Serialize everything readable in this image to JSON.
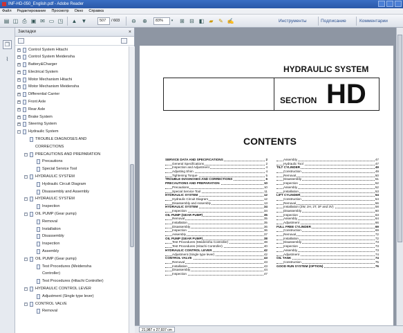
{
  "window": {
    "title": "INF-HD-050_English.pdf - Adobe Reader"
  },
  "menu": [
    "Файл",
    "Редактирование",
    "Просмотр",
    "Окно",
    "Справка"
  ],
  "toolbar": {
    "page_current": "507",
    "page_total": "/ 603",
    "zoom": "83%",
    "links": [
      "Инструменты",
      "Подписание",
      "Комментарии"
    ]
  },
  "panel": {
    "title": "Закладки"
  },
  "tree": [
    {
      "label": "Control System Hitachi",
      "level": 0,
      "exp": "+"
    },
    {
      "label": "Control System Meidensha",
      "level": 0,
      "exp": "+"
    },
    {
      "label": "Battery&Charger",
      "level": 0,
      "exp": "+"
    },
    {
      "label": "Electrical System",
      "level": 0,
      "exp": "+"
    },
    {
      "label": "Motor Mechanism Hitachi",
      "level": 0,
      "exp": "+"
    },
    {
      "label": "Motor Mechanism Meidensha",
      "level": 0,
      "exp": "+"
    },
    {
      "label": "Differential Carrier",
      "level": 0,
      "exp": "+"
    },
    {
      "label": "Front Axle",
      "level": 0,
      "exp": "+"
    },
    {
      "label": "Rear Axle",
      "level": 0,
      "exp": "+"
    },
    {
      "label": "Brake System",
      "level": 0,
      "exp": "+"
    },
    {
      "label": "Steering System",
      "level": 0,
      "exp": "+"
    },
    {
      "label": "Hydraulic System",
      "level": 0,
      "exp": "−"
    },
    {
      "label": "TROUBLE DIAGNOSES AND",
      "level": 1,
      "exp": ""
    },
    {
      "label": "CORRECTIONS",
      "level": 1,
      "exp": "",
      "cont": true
    },
    {
      "label": "PRECAUTIONS AND PREPARATION",
      "level": 1,
      "exp": "−"
    },
    {
      "label": "Precautions",
      "level": 2,
      "exp": ""
    },
    {
      "label": "Special Service Tool",
      "level": 2,
      "exp": ""
    },
    {
      "label": "HYDRAULIC SYSTEM",
      "level": 1,
      "exp": "−"
    },
    {
      "label": "Hydraulic Circuit Diagram",
      "level": 2,
      "exp": ""
    },
    {
      "label": "Disassembly and Assembly",
      "level": 2,
      "exp": ""
    },
    {
      "label": "HYDRAULIC SYSTEM",
      "level": 1,
      "exp": "−"
    },
    {
      "label": "Inspection",
      "level": 2,
      "exp": ""
    },
    {
      "label": "OIL PUMP (Gear pump)",
      "level": 1,
      "exp": "−"
    },
    {
      "label": "Removal",
      "level": 2,
      "exp": ""
    },
    {
      "label": "Installation",
      "level": 2,
      "exp": ""
    },
    {
      "label": "Disassembly",
      "level": 2,
      "exp": ""
    },
    {
      "label": "Inspection",
      "level": 2,
      "exp": ""
    },
    {
      "label": "Assembly",
      "level": 2,
      "exp": ""
    },
    {
      "label": "OIL PUMP (Gear pump)",
      "level": 1,
      "exp": "−"
    },
    {
      "label": "Test Procedures (Meidensha",
      "level": 2,
      "exp": ""
    },
    {
      "label": "Controller)",
      "level": 2,
      "exp": "",
      "cont": true
    },
    {
      "label": "Test Procedures (Hitachi Controller)",
      "level": 2,
      "exp": ""
    },
    {
      "label": "HYDRAULIC CONTROL LEVER",
      "level": 1,
      "exp": "−"
    },
    {
      "label": "Adjustment (Single type lever)",
      "level": 2,
      "exp": ""
    },
    {
      "label": "CONTROL VALVE",
      "level": 1,
      "exp": "−"
    },
    {
      "label": "Removal",
      "level": 2,
      "exp": ""
    }
  ],
  "doc": {
    "header": "HYDRAULIC SYSTEM",
    "section_word": "SECTION",
    "section_code": "HD",
    "contents": "CONTENTS",
    "toc_left": [
      {
        "t": "SERVICE DATA AND SPECIFICATIONS",
        "p": "2",
        "b": true
      },
      {
        "t": "General Specifications",
        "p": "2"
      },
      {
        "t": "Inspection and Adjustment",
        "p": "4"
      },
      {
        "t": "Adjusting Shim",
        "p": "4"
      },
      {
        "t": "Tightening Torque",
        "p": "5"
      },
      {
        "t": "TROUBLE DIAGNOSES AND CORRECTIONS",
        "p": "6",
        "b": true
      },
      {
        "t": "PRECAUTIONS AND PREPARATION",
        "p": "10",
        "b": true
      },
      {
        "t": "Precautions",
        "p": "10"
      },
      {
        "t": "Special Service Tool",
        "p": "11"
      },
      {
        "t": "HYDRAULIC SYSTEM",
        "p": "12",
        "b": true
      },
      {
        "t": "Hydraulic Circuit Diagram",
        "p": "12"
      },
      {
        "t": "Disassembly and Assembly",
        "p": "13"
      },
      {
        "t": "HYDRAULIC SYSTEM",
        "p": "34",
        "b": true
      },
      {
        "t": "Inspection",
        "p": "34"
      },
      {
        "t": "OIL PUMP (GEAR PUMP)",
        "p": "35",
        "b": true
      },
      {
        "t": "Removal",
        "p": "35"
      },
      {
        "t": "Installation",
        "p": "35"
      },
      {
        "t": "Disassembly",
        "p": "36"
      },
      {
        "t": "Inspection",
        "p": "36"
      },
      {
        "t": "Assembly",
        "p": "37"
      },
      {
        "t": "OIL PUMP (GEAR PUMP)",
        "p": "38",
        "b": true
      },
      {
        "t": "Test Procedures (Meidensha Controller)",
        "p": "38"
      },
      {
        "t": "Test Procedures (Hitachi Controller)",
        "p": "40"
      },
      {
        "t": "HYDRAULIC CONTROL LEVER",
        "p": "42",
        "b": true
      },
      {
        "t": "Adjustment (Single type lever)",
        "p": "42"
      },
      {
        "t": "CONTROL VALVE",
        "p": "43",
        "b": true
      },
      {
        "t": "Removal",
        "p": "43"
      },
      {
        "t": "Installation",
        "p": "43"
      },
      {
        "t": "Disassembly",
        "p": "44"
      },
      {
        "t": "Inspection",
        "p": "47"
      }
    ],
    "toc_right": [
      {
        "t": "Assembly",
        "p": "47"
      },
      {
        "t": "Hydraulic Tool",
        "p": "47"
      },
      {
        "t": "TILT CYLINDER",
        "p": "49",
        "b": true
      },
      {
        "t": "Construction",
        "p": "49"
      },
      {
        "t": "Removal",
        "p": "50"
      },
      {
        "t": "Disassembly",
        "p": "51"
      },
      {
        "t": "Inspection",
        "p": "52"
      },
      {
        "t": "Assembly",
        "p": "52"
      },
      {
        "t": "Installation",
        "p": "53"
      },
      {
        "t": "LIFT CYLINDER",
        "p": "54",
        "b": true
      },
      {
        "t": "Construction",
        "p": "54"
      },
      {
        "t": "Removal",
        "p": "56"
      },
      {
        "t": "Installation (2W, 2H, 2T, 3F and 3V)",
        "p": "58"
      },
      {
        "t": "Disassembly",
        "p": "60"
      },
      {
        "t": "Inspection",
        "p": "63"
      },
      {
        "t": "Assembly",
        "p": "64"
      },
      {
        "t": "Adjustment",
        "p": "66"
      },
      {
        "t": "FULL FREE CYLINDER",
        "p": "69",
        "b": true
      },
      {
        "t": "Construction",
        "p": "69"
      },
      {
        "t": "Removal",
        "p": "72"
      },
      {
        "t": "Installation",
        "p": "72"
      },
      {
        "t": "Disassembly",
        "p": "73"
      },
      {
        "t": "Inspection",
        "p": "73"
      },
      {
        "t": "Assembly",
        "p": "73"
      },
      {
        "t": "Adjustment",
        "p": "74"
      },
      {
        "t": "OIL TANK",
        "p": "74",
        "b": true
      },
      {
        "t": "Construction",
        "p": "75"
      },
      {
        "t": "GOOD RUN SYSTEM (OPTION)",
        "p": "76",
        "b": true
      }
    ]
  },
  "status": {
    "page_size": "21,987 x 27,937 cm"
  }
}
